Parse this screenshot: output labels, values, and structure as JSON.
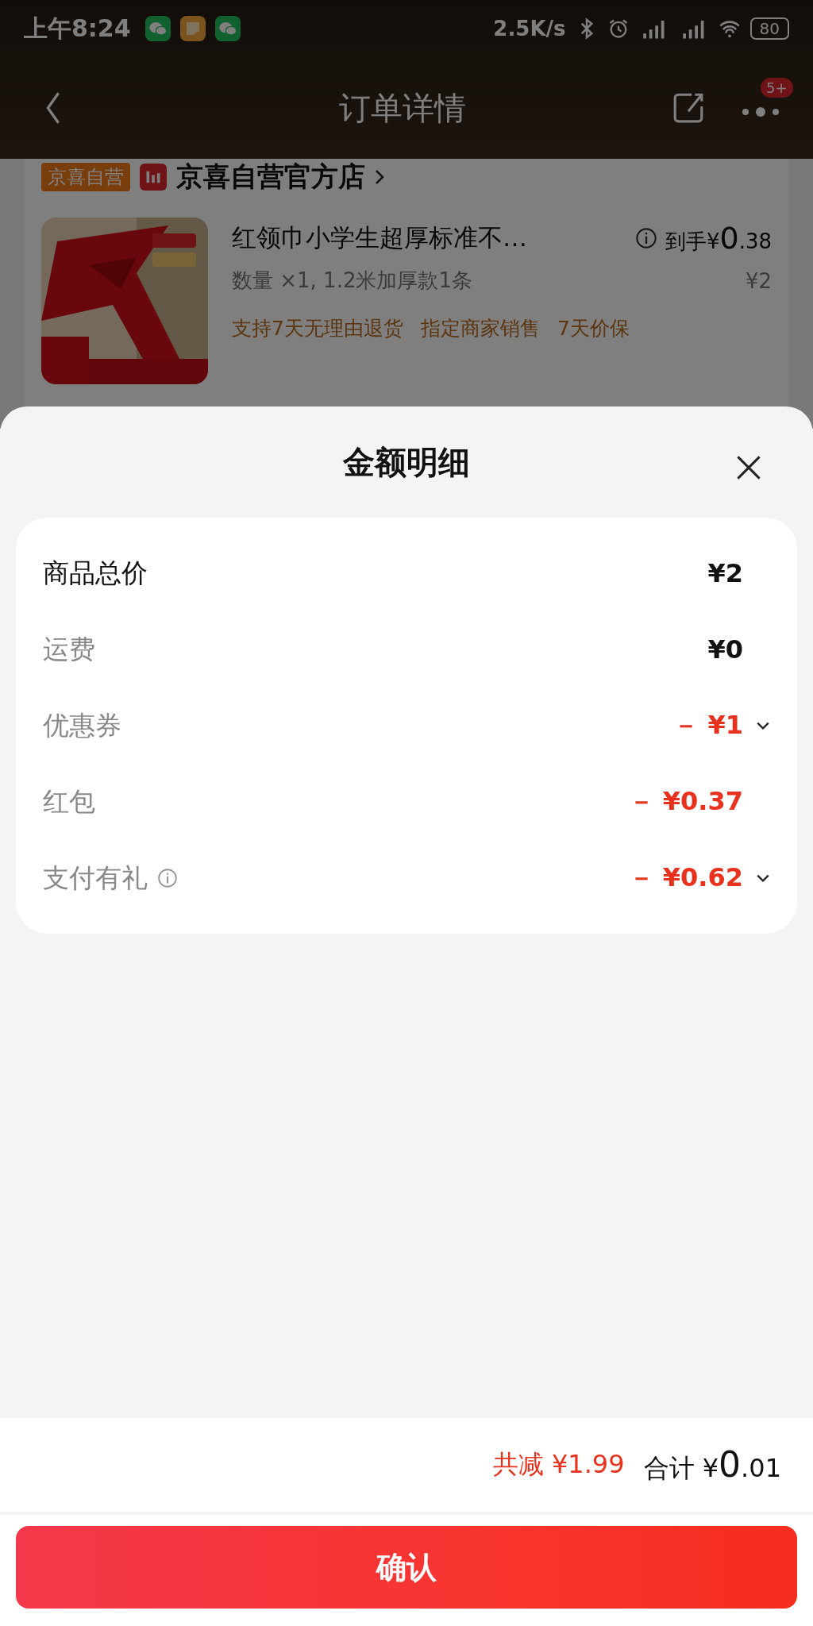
{
  "status_bar": {
    "time": "上午8:24",
    "speed": "2.5K/s",
    "battery": "80"
  },
  "nav": {
    "title": "订单详情",
    "badge": "5+"
  },
  "shop": {
    "tag": "京喜自营",
    "name": "京喜自营官方店"
  },
  "product": {
    "kind": "picture",
    "title": "红领巾小学生超厚标准不…",
    "price_prefix": "到手¥",
    "price_int": "0",
    "price_dec": ".38",
    "spec": "数量 ×1, 1.2米加厚款1条",
    "original_price": "¥2",
    "tags": [
      "支持7天无理由退货",
      "指定商家销售",
      "7天价保"
    ]
  },
  "sheet": {
    "title": "金额明细",
    "rows": [
      {
        "label": "商品总价",
        "value": "¥2",
        "kind": "charge",
        "primary": true,
        "info": false,
        "expandable": false
      },
      {
        "label": "运费",
        "value": "¥0",
        "kind": "charge",
        "primary": false,
        "info": false,
        "expandable": false
      },
      {
        "label": "优惠券",
        "value": "－ ¥1",
        "kind": "discount",
        "primary": false,
        "info": false,
        "expandable": true
      },
      {
        "label": "红包",
        "value": "－ ¥0.37",
        "kind": "discount",
        "primary": false,
        "info": false,
        "expandable": false
      },
      {
        "label": "支付有礼",
        "value": "－ ¥0.62",
        "kind": "discount",
        "primary": false,
        "info": true,
        "expandable": true
      }
    ]
  },
  "footer": {
    "saved": "共减 ¥1.99",
    "total_label": "合计",
    "total_currency": "¥",
    "total_int": "0",
    "total_dec": ".01",
    "confirm": "确认"
  }
}
